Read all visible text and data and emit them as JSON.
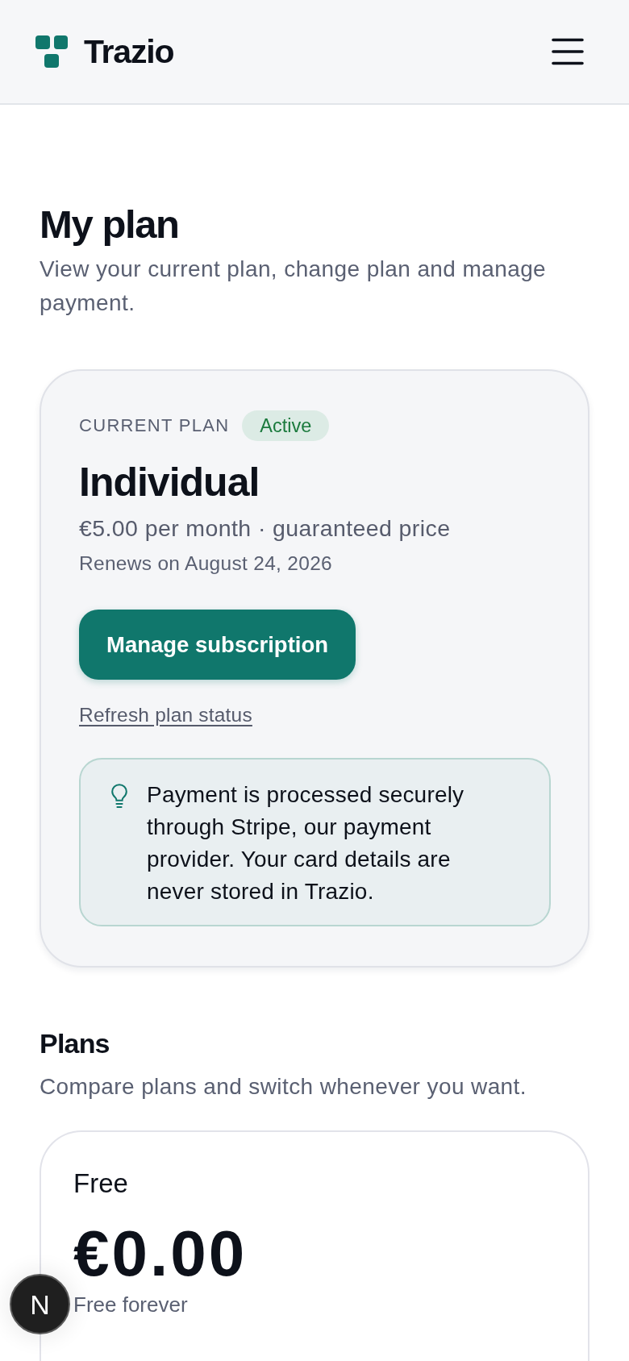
{
  "header": {
    "brand": "Trazio"
  },
  "page": {
    "title": "My plan",
    "subtitle": "View your current plan, change plan and manage payment."
  },
  "current_plan": {
    "label": "CURRENT PLAN",
    "status": "Active",
    "name": "Individual",
    "price": "€5.00 per month · guaranteed price",
    "renewal": "Renews on August 24, 2026",
    "primary_button": "Manage subscription",
    "link": "Refresh plan status",
    "notice": "Payment is processed securely through Stripe, our payment provider. Your card details are never stored in Trazio."
  },
  "plans_section": {
    "title": "Plans",
    "subtitle": "Compare plans and switch whenever you want.",
    "plans": [
      {
        "name": "Free",
        "price": "€0.00",
        "note": "Free forever"
      }
    ]
  },
  "dev_indicator": {
    "label": "N"
  }
}
